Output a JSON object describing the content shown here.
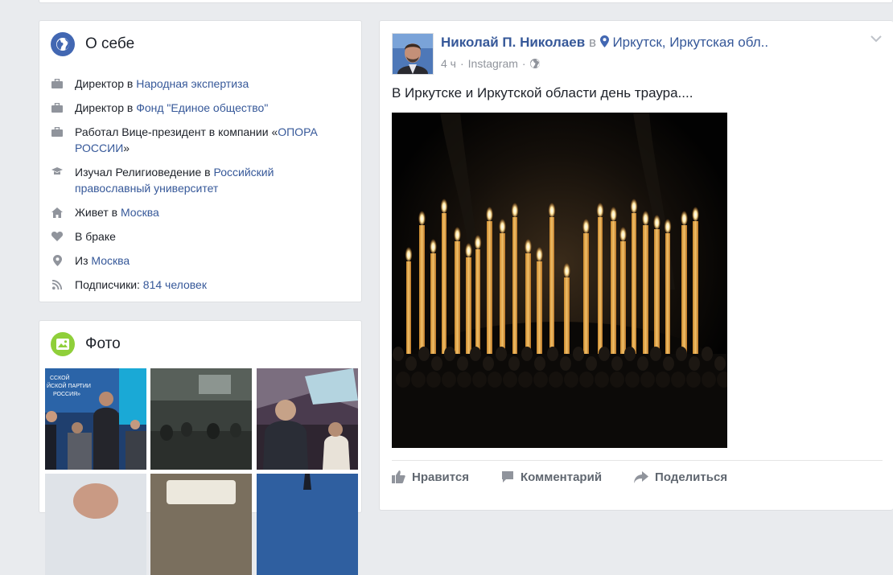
{
  "about": {
    "title": "О себе",
    "items": [
      {
        "icon": "briefcase-icon",
        "prefix": "Директор в ",
        "link": "Народная экспертиза",
        "suffix": ""
      },
      {
        "icon": "briefcase-icon",
        "prefix": "Директор в ",
        "link": "Фонд \"Единое общество\"",
        "suffix": ""
      },
      {
        "icon": "briefcase-icon",
        "prefix": "Работал Вице-президент в компании «",
        "link": "ОПОРА РОССИИ",
        "suffix": "»"
      },
      {
        "icon": "graduation-cap-icon",
        "prefix": "Изучал Религиоведение в ",
        "link": "Российский православный университет",
        "suffix": ""
      },
      {
        "icon": "home-icon",
        "prefix": "Живет в ",
        "link": "Москва",
        "suffix": ""
      },
      {
        "icon": "heart-icon",
        "prefix": "В браке",
        "link": "",
        "suffix": ""
      },
      {
        "icon": "location-pin-icon",
        "prefix": "Из ",
        "link": "Москва",
        "suffix": ""
      },
      {
        "icon": "rss-icon",
        "prefix": "Подписчики: ",
        "link": "814 человек",
        "suffix": ""
      }
    ]
  },
  "photos": {
    "title": "Фото",
    "thumb_text": "ССКОЙ\nЙСКОЙ ПАРТИИ\nРОССИЯ»"
  },
  "post": {
    "author": "Николай П. Николаев",
    "in_word": "в",
    "location": "Иркутск, Иркутская обл..",
    "time": "4 ч",
    "separator": "·",
    "source": "Instagram",
    "text": "В Иркутске и Иркутской области день траура....",
    "actions": {
      "like": "Нравится",
      "comment": "Комментарий",
      "share": "Поделиться"
    }
  },
  "colors": {
    "link": "#365899",
    "background": "#e9ebee",
    "globe_icon": "#4267b2",
    "photo_icon": "#8fcf3a"
  }
}
